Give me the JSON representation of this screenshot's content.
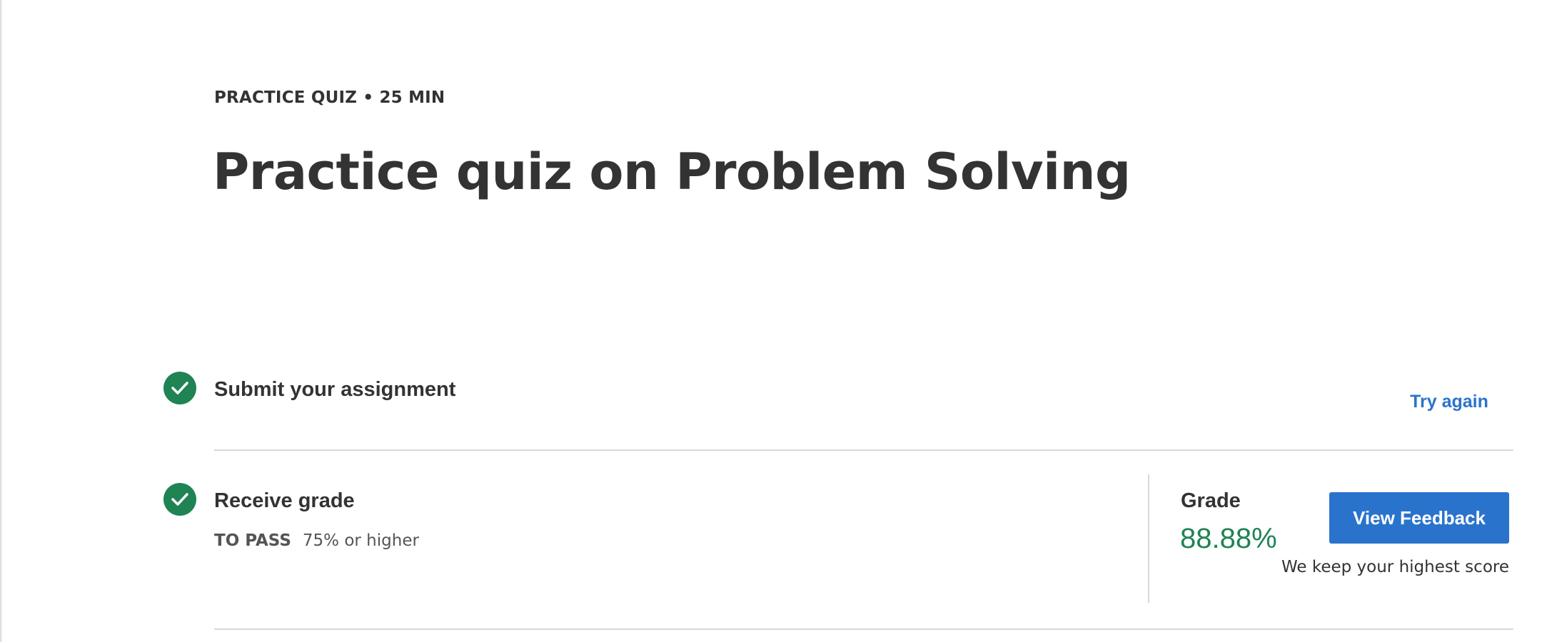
{
  "header": {
    "eyebrow": "PRACTICE QUIZ • 25 MIN",
    "title": "Practice quiz on Problem Solving"
  },
  "steps": {
    "submit": {
      "title": "Submit your assignment",
      "action_label": "Try again",
      "status_icon": "check-circle-icon"
    },
    "grade": {
      "title": "Receive grade",
      "to_pass_label": "TO PASS",
      "to_pass_value": "75% or higher",
      "status_icon": "check-circle-icon"
    }
  },
  "grade_panel": {
    "label": "Grade",
    "value": "88.88%",
    "button_label": "View Feedback",
    "note": "We keep your highest score"
  },
  "colors": {
    "accent": "#2a73cc",
    "success": "#1f8354",
    "text": "#333333",
    "divider": "#d8d8d8"
  }
}
